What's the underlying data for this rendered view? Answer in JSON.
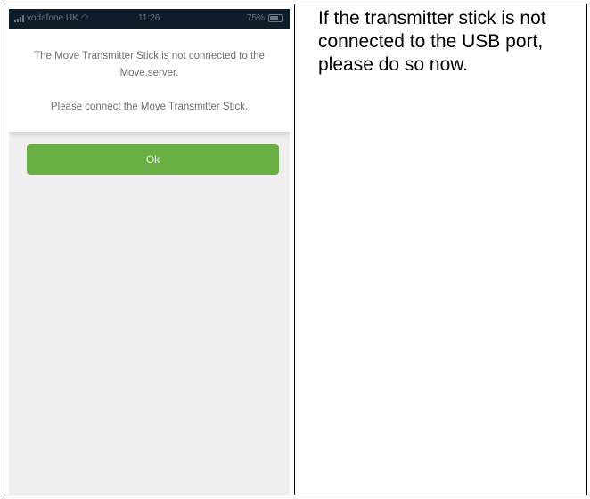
{
  "status_bar": {
    "carrier": "vodafone UK",
    "time": "11:26",
    "battery": "75%"
  },
  "dialog": {
    "message_line1": "The Move Transmitter Stick is not connected to the Move.server.",
    "message_line2": "Please connect the Move Transmitter Stick.",
    "ok_label": "Ok"
  },
  "instruction_text": "If the transmitter stick is not connected to the USB port, please do so now.",
  "colors": {
    "ok_button": "#6aaf43",
    "status_bar_bg": "#111c2a",
    "screen_bg": "#efefef"
  }
}
